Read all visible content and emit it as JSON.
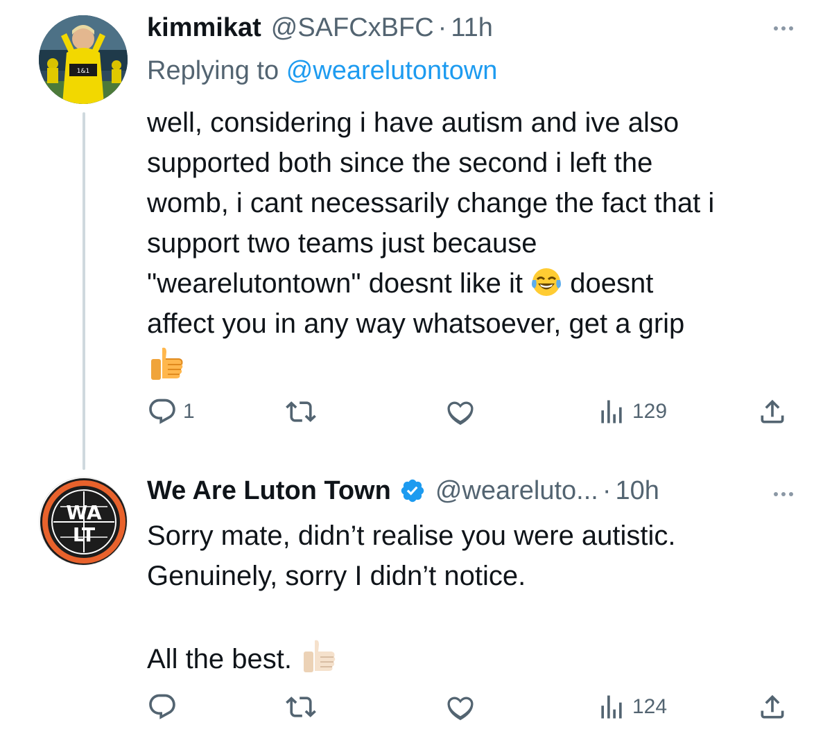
{
  "tweets": [
    {
      "display_name": "kimmikat",
      "handle": "@SAFCxBFC",
      "separator": "·",
      "time": "11h",
      "replying_prefix": "Replying to",
      "replying_to": "@wearelutontown",
      "body_lines": [
        "well, considering i have autism and ive also",
        "supported both since the second i left the",
        "womb, i cant necessarily change the fact that i",
        "support two teams just because"
      ],
      "body_line5_a": "\"wearelutontown\" doesnt like it",
      "body_line5_b": "doesnt",
      "body_line6": "affect you in any way whatsoever, get a grip",
      "emojis": [
        "face-with-tears-of-joy",
        "thumbs-up"
      ],
      "stats": {
        "replies": "1",
        "retweets": "",
        "likes": "",
        "views": "129"
      }
    },
    {
      "display_name": "We Are Luton Town",
      "verified": true,
      "handle": "@weareluto...",
      "separator": "·",
      "time": "10h",
      "avatar_text": [
        "WA",
        "LT"
      ],
      "body_lines": [
        "Sorry mate, didn’t realise you were autistic.",
        "Genuinely, sorry I didn’t notice.",
        "",
        "All the best."
      ],
      "emojis": [
        "thumbs-up-light-skin"
      ],
      "stats": {
        "replies": "",
        "retweets": "",
        "likes": "",
        "views": "124"
      }
    }
  ],
  "colors": {
    "text": "#0f1419",
    "secondary": "#536471",
    "link": "#1d9bf0",
    "verified": "#1d9bf0",
    "thread_line": "#cfd9de"
  },
  "icons": [
    "reply-icon",
    "retweet-icon",
    "like-icon",
    "views-icon",
    "share-icon",
    "more-icon",
    "verified-icon"
  ]
}
